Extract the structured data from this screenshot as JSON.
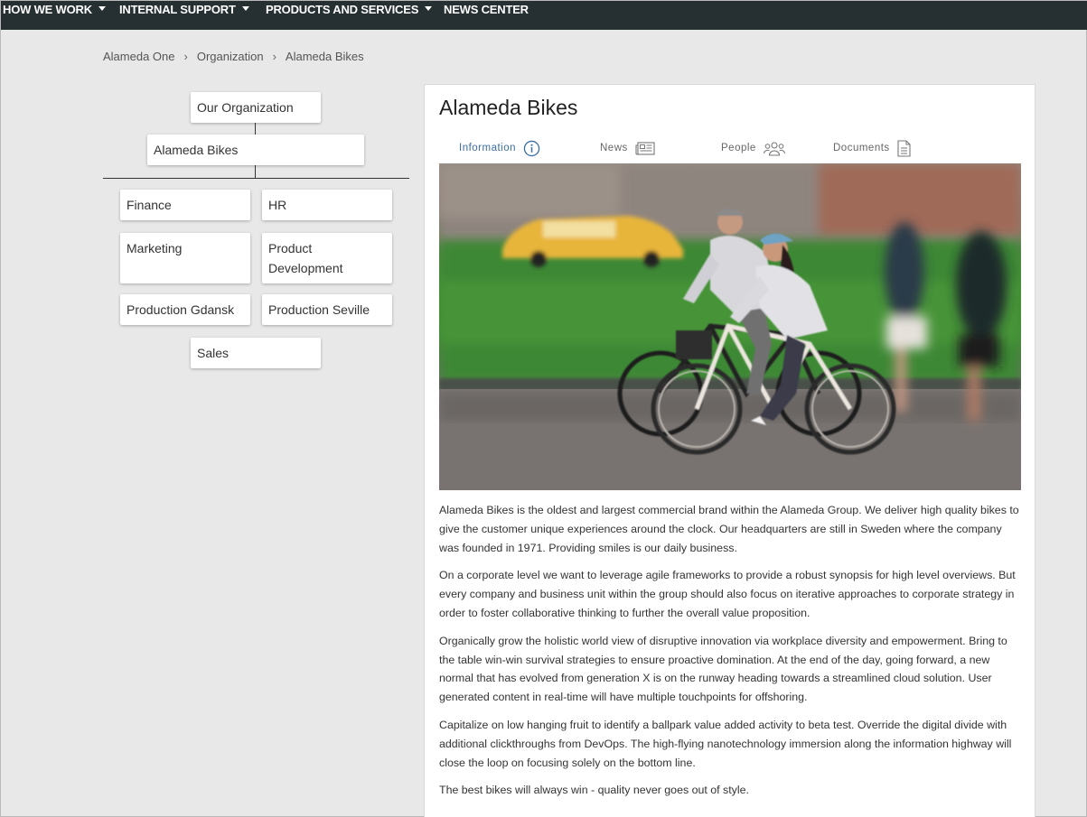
{
  "nav": {
    "items": [
      {
        "label": "HOW WE WORK",
        "has_dropdown": true
      },
      {
        "label": "INTERNAL SUPPORT",
        "has_dropdown": true
      },
      {
        "label": "PRODUCTS AND SERVICES",
        "has_dropdown": true
      },
      {
        "label": "NEWS CENTER",
        "has_dropdown": false
      }
    ]
  },
  "breadcrumb": [
    "Alameda One",
    "Organization",
    "Alameda Bikes"
  ],
  "org_chart": {
    "root": "Our Organization",
    "current": "Alameda Bikes",
    "children": [
      "Finance",
      "HR",
      "Marketing",
      "Product Development",
      "Production Gdansk",
      "Production Seville",
      "Sales"
    ]
  },
  "panel": {
    "title": "Alameda Bikes",
    "tabs": [
      {
        "label": "Information",
        "icon": "info-icon",
        "active": true
      },
      {
        "label": "News",
        "icon": "newspaper-icon",
        "active": false
      },
      {
        "label": "People",
        "icon": "people-icon",
        "active": false
      },
      {
        "label": "Documents",
        "icon": "document-icon",
        "active": false
      }
    ],
    "hero_image": "cyclists-photo",
    "paragraphs": [
      "Alameda Bikes is the oldest and largest commercial brand within the Alameda Group. We deliver high quality bikes to give the customer unique experiences around the clock. Our headquarters are still in Sweden where the company was founded in 1971. Providing smiles is our daily business.",
      "On a corporate level we want to leverage agile frameworks to provide a robust synopsis for high level overviews. But every company and business unit within the group should also focus on iterative approaches to corporate strategy in order to foster collaborative thinking to further the overall value proposition.",
      "Organically grow the holistic world view of disruptive innovation via workplace diversity and empowerment. Bring to the table win-win survival strategies to ensure proactive domination. At the end of the day, going forward, a new normal that has evolved from generation X is on the runway heading towards a streamlined cloud solution. User generated content in real-time will have multiple touchpoints for offshoring.",
      "Capitalize on low hanging fruit to identify a ballpark value added activity to beta test. Override the digital divide with additional clickthroughs from DevOps. The high-flying nanotechnology immersion along the information highway will close the loop on focusing solely on the bottom line.",
      "The best bikes will always win - quality never goes out of style."
    ]
  },
  "colors": {
    "nav_bg": "#263032",
    "accent": "#3a6ea5",
    "page_bg": "#e8e8e8"
  }
}
